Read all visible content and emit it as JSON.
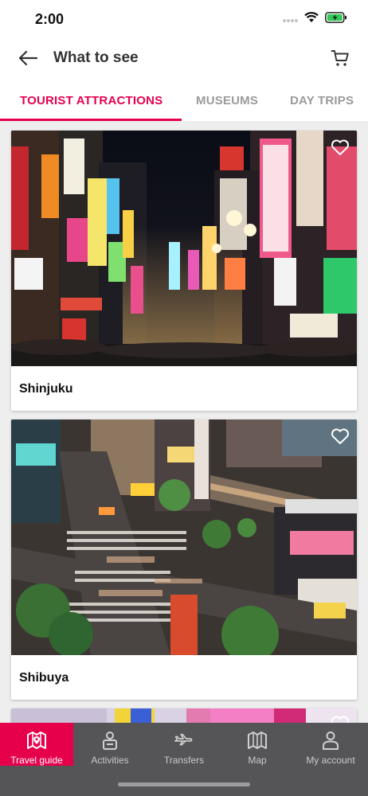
{
  "status_bar": {
    "time": "2:00"
  },
  "header": {
    "title": "What to see"
  },
  "tabs": [
    {
      "label": "TOURIST ATTRACTIONS"
    },
    {
      "label": "MUSEUMS"
    },
    {
      "label": "DAY TRIPS"
    }
  ],
  "cards": [
    {
      "title": "Shinjuku"
    },
    {
      "title": "Shibuya"
    }
  ],
  "bottom_nav": {
    "items": [
      {
        "label": "Travel guide"
      },
      {
        "label": "Activities"
      },
      {
        "label": "Transfers"
      },
      {
        "label": "Map"
      },
      {
        "label": "My account"
      }
    ]
  },
  "colors": {
    "accent": "#e6004c",
    "nav_bg": "#555557",
    "battery": "#34c759"
  }
}
